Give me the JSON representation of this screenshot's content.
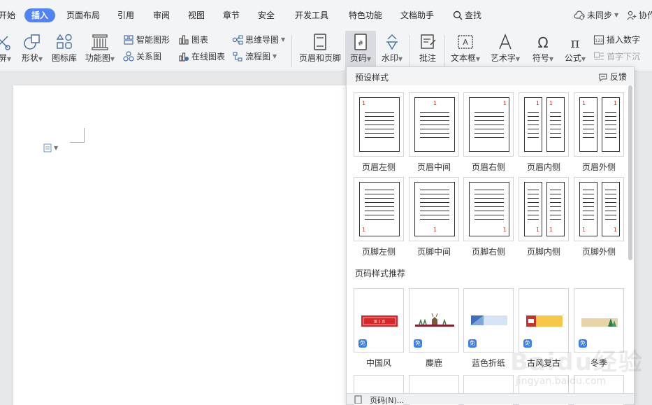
{
  "menu": {
    "tabs": [
      "开始",
      "插入",
      "页面布局",
      "引用",
      "审阅",
      "视图",
      "章节",
      "安全",
      "开发工具",
      "特色功能",
      "文档助手"
    ],
    "active_tab": "插入",
    "search_label": "查找",
    "sync_label": "未同步",
    "collab_label": "协作"
  },
  "ribbon": {
    "screen_label": "屏",
    "shape_label": "形状",
    "icon_lib_label": "图标库",
    "func_chart_label": "功能图",
    "smart_shape_label": "智能图形",
    "chart_label": "图表",
    "relation_label": "关系图",
    "online_chart_label": "在线图表",
    "mindmap_label": "思维导图",
    "flowchart_label": "流程图",
    "header_footer_label": "页眉和页脚",
    "page_number_label": "页码",
    "watermark_label": "水印",
    "comment_label": "批注",
    "textbox_label": "文本框",
    "wordart_label": "艺术字",
    "symbol_label": "符号",
    "formula_label": "公式",
    "insert_number_label": "插入数字",
    "drop_cap_label": "首字下沉"
  },
  "panel": {
    "preset_title": "预设样式",
    "feedback_label": "反馈",
    "recommend_title": "页码样式推荐",
    "presets": [
      {
        "name": "页眉左侧",
        "num": "1"
      },
      {
        "name": "页眉中间",
        "num": "1"
      },
      {
        "name": "页眉右侧",
        "num": "1"
      },
      {
        "name": "页眉内侧",
        "num": "1"
      },
      {
        "name": "页眉外侧",
        "num": "1"
      },
      {
        "name": "页脚左侧",
        "num": "1"
      },
      {
        "name": "页脚中间",
        "num": "1"
      },
      {
        "name": "页脚右侧",
        "num": "1"
      },
      {
        "name": "页脚内侧",
        "num": "1"
      },
      {
        "name": "页脚外侧",
        "num": "1"
      }
    ],
    "recommend": [
      {
        "name": "中国风",
        "badge": "免",
        "text": "第 1 页"
      },
      {
        "name": "麋鹿",
        "badge": "免"
      },
      {
        "name": "蓝色折纸",
        "badge": "免"
      },
      {
        "name": "古风复古",
        "badge": "免"
      },
      {
        "name": "冬季",
        "badge": "免"
      }
    ],
    "footer_label": "页码(N)..."
  },
  "watermark": {
    "main": "Baidu经验",
    "sub": "jingyan.baidu.com"
  },
  "colors": {
    "accent": "#4f83f6",
    "ribbon_bg": "#f3f4f6",
    "doc_bg": "#e7e8ea",
    "badge": "#3a7ef0",
    "page_num": "#c0392b"
  }
}
